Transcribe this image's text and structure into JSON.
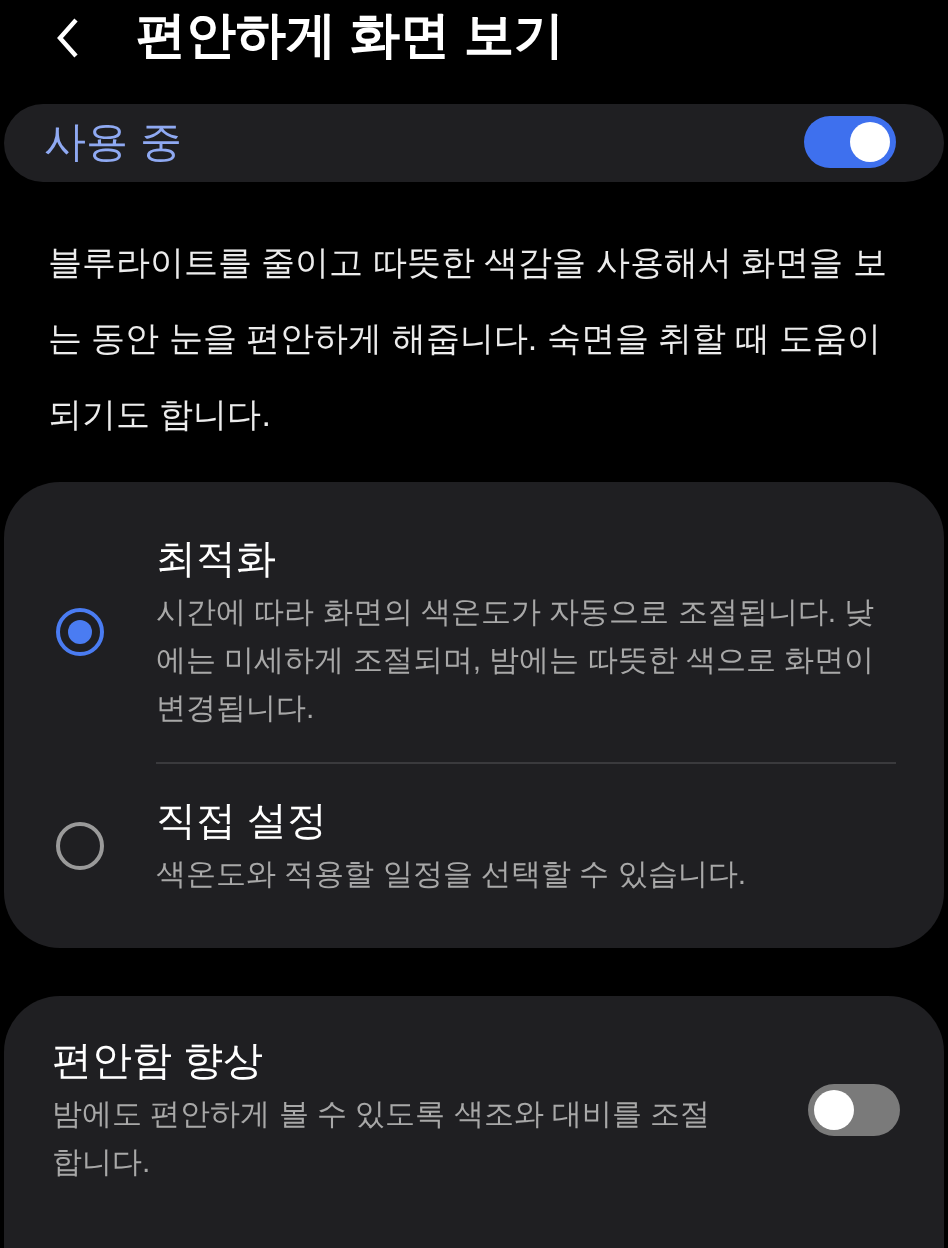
{
  "header": {
    "title": "편안하게 화면 보기"
  },
  "master": {
    "label": "사용 중",
    "on": true
  },
  "description": "블루라이트를 줄이고 따뜻한 색감을 사용해서 화면을 보는 동안 눈을 편안하게 해줍니다. 숙면을 취할 때 도움이 되기도 합니다.",
  "modes": [
    {
      "title": "최적화",
      "text": "시간에 따라 화면의 색온도가 자동으로 조절됩니다. 낮에는 미세하게 조절되며, 밤에는 따뜻한 색으로 화면이 변경됩니다.",
      "selected": true
    },
    {
      "title": "직접 설정",
      "text": "색온도와 적용할 일정을 선택할 수 있습니다.",
      "selected": false
    }
  ],
  "comfort": {
    "title": "편안함 향상",
    "text": "밤에도 편안하게 볼 수 있도록 색조와 대비를 조절합니다.",
    "on": false
  }
}
